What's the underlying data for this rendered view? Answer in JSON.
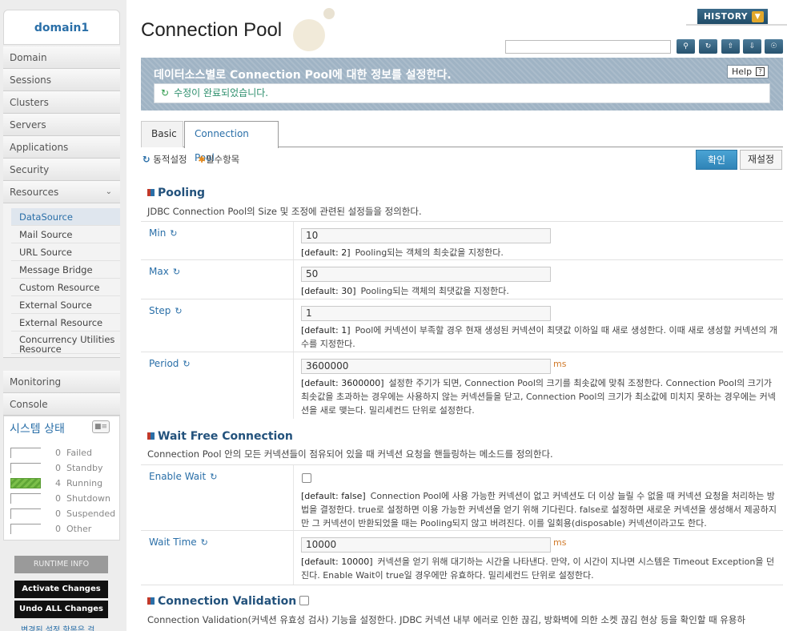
{
  "sidebar": {
    "domain": "domain1",
    "nav": [
      "Domain",
      "Sessions",
      "Clusters",
      "Servers",
      "Applications",
      "Security",
      "Resources"
    ],
    "resources_sub": [
      "DataSource",
      "Mail Source",
      "URL Source",
      "Message Bridge",
      "Custom Resource",
      "External Source",
      "External Resource",
      "Concurrency Utilities Resource"
    ],
    "nav_bottom": [
      "Monitoring",
      "Console"
    ],
    "system_status": {
      "title": "시스템 상태",
      "items": [
        {
          "count": "0",
          "label": "Failed"
        },
        {
          "count": "0",
          "label": "Standby"
        },
        {
          "count": "4",
          "label": "Running"
        },
        {
          "count": "0",
          "label": "Shutdown"
        },
        {
          "count": "0",
          "label": "Suspended"
        },
        {
          "count": "0",
          "label": "Other"
        }
      ]
    },
    "runtime_info": "RUNTIME INFO",
    "activate_changes": "Activate Changes",
    "undo_all_changes": "Undo ALL Changes",
    "more_text": "변경된 설정 항목은 걸"
  },
  "header": {
    "title": "Connection Pool",
    "history": "HISTORY"
  },
  "banner": {
    "text": "데이터소스별로 Connection Pool에 대한 정보를 설정한다.",
    "help": "Help",
    "success": "수정이 완료되었습니다."
  },
  "tabs": [
    "Basic",
    "Connection Pool"
  ],
  "legend": {
    "dynamic": "동적설정",
    "required": "필수항목"
  },
  "buttons": {
    "ok": "확인",
    "reset": "재설정"
  },
  "sections": {
    "pooling": {
      "title": "Pooling",
      "desc": "JDBC Connection Pool의 Size 및 조정에 관련된 설정들을 정의한다.",
      "fields": {
        "min": {
          "label": "Min",
          "value": "10",
          "default": "[default: 2]",
          "desc": "Pooling되는 객체의 최솟값을 지정한다."
        },
        "max": {
          "label": "Max",
          "value": "50",
          "default": "[default: 30]",
          "desc": "Pooling되는 객체의 최댓값을 지정한다."
        },
        "step": {
          "label": "Step",
          "value": "1",
          "default": "[default: 1]",
          "desc": "Pool에 커넥션이 부족할 경우 현재 생성된 커넥션이 최댓값 이하일 때 새로 생성한다. 이때 새로 생성할 커넥션의 개수를 지정한다."
        },
        "period": {
          "label": "Period",
          "value": "3600000",
          "unit": "ms",
          "default": "[default: 3600000]",
          "desc": "설정한 주기가 되면, Connection Pool의 크기를 최솟값에 맞춰 조정한다. Connection Pool의 크기가 최솟값을 초과하는 경우에는 사용하지 않는 커넥션들을 닫고, Connection Pool의 크기가 최소값에 미치지 못하는 경우에는 커넥션을 새로 맺는다. 밀리세컨드 단위로 설정한다."
        }
      }
    },
    "wait": {
      "title": "Wait Free Connection",
      "desc": "Connection Pool 안의 모든 커넥션들이 점유되어 있을 때 커넥션 요청을 핸들링하는 메소드를 정의한다.",
      "fields": {
        "enable_wait": {
          "label": "Enable Wait",
          "checked": false,
          "default": "[default: false]",
          "desc": "Connection Pool에 사용 가능한 커넥션이 없고 커넥션도 더 이상 늘릴 수 없을 때 커넥션 요청을 처리하는 방법을 결정한다. true로 설정하면 이용 가능한 커넥션을 얻기 위해 기다린다. false로 설정하면 새로운 커넥션을 생성해서 제공하지만 그 커넥션이 반환되었을 때는 Pooling되지 않고 버려진다. 이를 일회용(disposable) 커넥션이라고도 한다."
        },
        "wait_time": {
          "label": "Wait Time",
          "value": "10000",
          "unit": "ms",
          "default": "[default: 10000]",
          "desc": "커넥션을 얻기 위해 대기하는 시간을 나타낸다. 만약, 이 시간이 지나면 시스템은 Timeout Exception을 던진다. Enable Wait이 true일 경우에만 유효하다. 밀리세컨드 단위로 설정한다."
        }
      }
    },
    "validation": {
      "title": "Connection Validation",
      "desc": "Connection Validation(커넥션 유효성 검사) 기능을 설정한다. JDBC 커넥션 내부 에러로 인한 끊김, 방화벽에 의한 소켓 끊김 현상 등을 확인할 때 유용하"
    }
  }
}
